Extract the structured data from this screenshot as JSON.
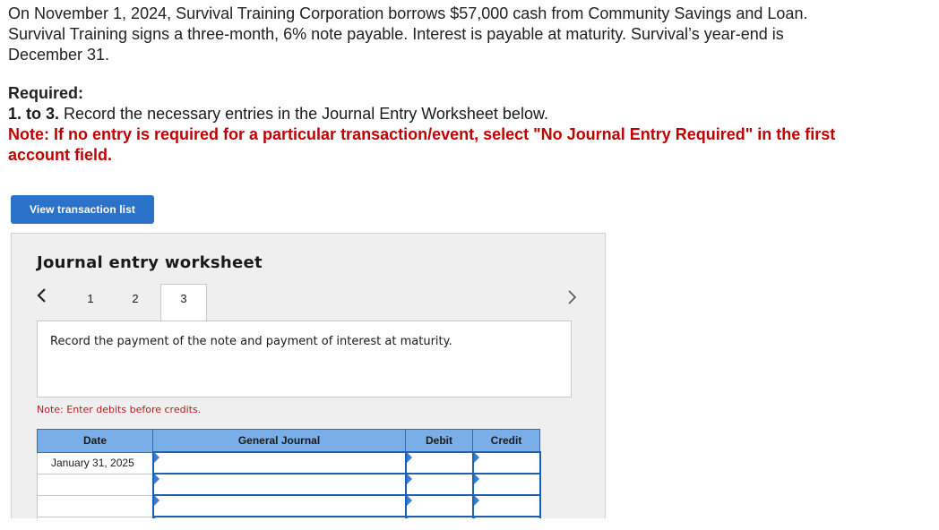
{
  "problem": {
    "intro": "On November 1, 2024, Survival Training Corporation borrows $57,000 cash from Community Savings and Loan. Survival Training signs a three-month, 6% note payable. Interest is payable at maturity. Survival’s year-end is December 31.",
    "required_heading": "Required:",
    "step_number": "1. to 3.",
    "step_text": " Record the necessary entries in the Journal Entry Worksheet below.",
    "note": "Note: If no entry is required for a particular transaction/event, select \"No Journal Entry Required\" in the first account field."
  },
  "buttons": {
    "view_transactions": "View transaction list"
  },
  "worksheet": {
    "title": "Journal entry worksheet",
    "tabs": [
      "1",
      "2",
      "3"
    ],
    "active_tab": "3",
    "prompt": "Record the payment of the note and payment of interest at maturity.",
    "note": "Note: Enter debits before credits.",
    "table": {
      "headers": {
        "date": "Date",
        "journal": "General Journal",
        "debit": "Debit",
        "credit": "Credit"
      },
      "rows": [
        {
          "date": "January 31, 2025",
          "account": "",
          "debit": "",
          "credit": ""
        },
        {
          "date": "",
          "account": "",
          "debit": "",
          "credit": ""
        },
        {
          "date": "",
          "account": "",
          "debit": "",
          "credit": ""
        },
        {
          "date": "",
          "account": "",
          "debit": "",
          "credit": ""
        }
      ]
    }
  },
  "colors": {
    "note_red": "#c00000",
    "button_blue": "#2b73c8",
    "table_header_blue": "#7aaee8",
    "field_border_blue": "#1f5fb0"
  },
  "icons": {
    "prev": "chevron-left-icon",
    "next": "chevron-right-icon"
  }
}
